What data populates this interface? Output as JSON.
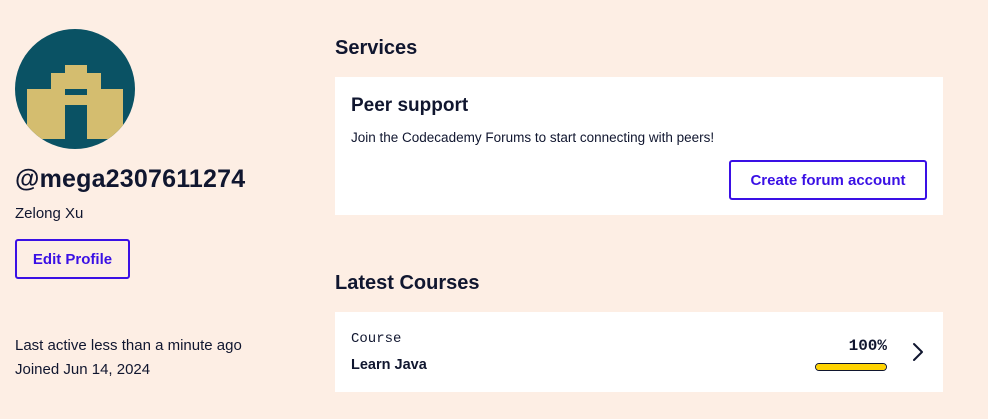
{
  "profile": {
    "username": "@mega2307611274",
    "full_name": "Zelong Xu",
    "edit_label": "Edit Profile",
    "last_active": "Last active less than a minute ago",
    "joined": "Joined Jun 14, 2024",
    "avatar_icon": "pixel-building-avatar-icon",
    "avatar_bg": "#0a5264",
    "avatar_fg": "#d4bd6f"
  },
  "services": {
    "title": "Services",
    "peer": {
      "title": "Peer support",
      "description": "Join the Codecademy Forums to start connecting with peers!",
      "button_label": "Create forum account"
    }
  },
  "courses": {
    "title": "Latest Courses",
    "items": [
      {
        "label": "Course",
        "name": "Learn Java",
        "progress_text": "100%",
        "progress": 1.0
      }
    ]
  },
  "colors": {
    "background": "#fdeee4",
    "accent": "#3a10e5",
    "text": "#10162f",
    "progress": "#ffd300"
  }
}
